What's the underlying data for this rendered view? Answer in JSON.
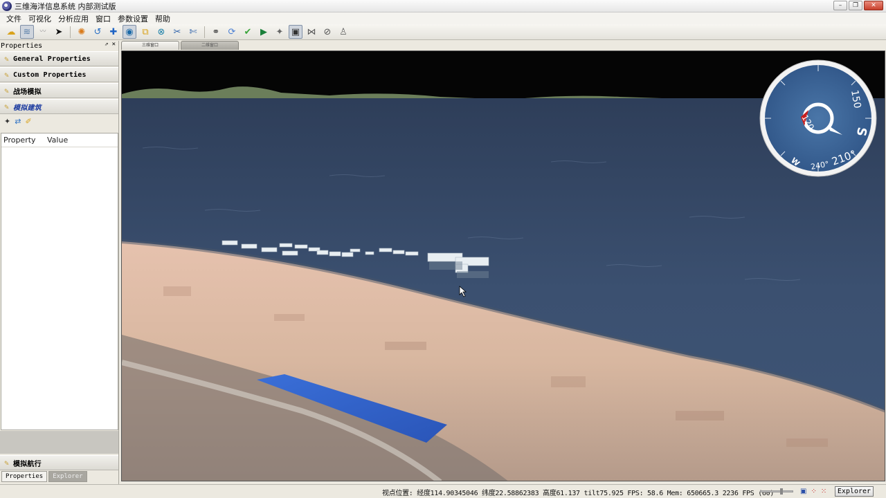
{
  "window": {
    "title": "三维海洋信息系统 内部测试版",
    "controls": [
      "–",
      "❐",
      "✕"
    ]
  },
  "menu": [
    "文件",
    "可视化",
    "分析应用",
    "窗口",
    "参数设置",
    "帮助"
  ],
  "toolbar": {
    "tools": [
      "weather-icon",
      "ocean-icon",
      "wave-icon",
      "pointer-icon",
      "globe-tool-icon",
      "undo-icon",
      "add-icon",
      "earth-icon",
      "layers-icon",
      "stop-icon",
      "measure-icon",
      "scissors-icon",
      "binoculars-icon",
      "sync-icon",
      "check-icon",
      "play-icon",
      "target-icon",
      "monitor-icon",
      "network-icon",
      "clock-icon",
      "user-icon"
    ]
  },
  "left_panel": {
    "header": "Properties",
    "sections": [
      {
        "label": "General Properties",
        "active": false
      },
      {
        "label": "Custom Properties",
        "active": false
      },
      {
        "label": "战场模拟",
        "active": false
      },
      {
        "label": "模拟建筑",
        "active": true
      }
    ],
    "table_headers": {
      "property": "Property",
      "value": "Value"
    },
    "bottom_section": "模拟航行",
    "bottom_tabs": [
      {
        "label": "Properties",
        "active": true
      },
      {
        "label": "Explorer",
        "active": false
      }
    ]
  },
  "view_tabs": [
    {
      "label": "三维窗口",
      "active": true
    },
    {
      "label": "二维窗口",
      "active": false
    }
  ],
  "compass": {
    "labels": [
      "120",
      "150",
      "S",
      "210°",
      "240°",
      "W"
    ]
  },
  "status": {
    "text": "视点位置: 经度114.90345046 纬度22.58862383 高度61.137 tilt75.925 FPS: 58.6  Mem: 650665.3 2236 FPS (60)",
    "explorer_button": "Explorer"
  },
  "colors": {
    "sea": "#3a4d6a",
    "beach": "#d9b69c",
    "compass_bg": "#3e6496",
    "accent_red": "#c81f1f"
  }
}
